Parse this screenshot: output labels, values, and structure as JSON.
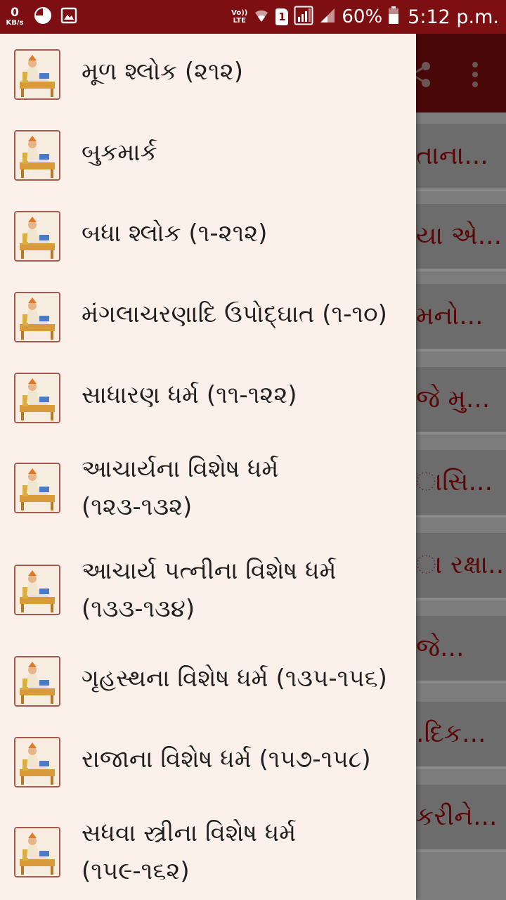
{
  "status_bar": {
    "data_speed_value": "0",
    "data_speed_unit": "KB/s",
    "network_top": "Vo))",
    "network_bottom": "LTE",
    "sim_number": "1",
    "battery_percent": "60%",
    "time": "5:12 p.m."
  },
  "background_list": {
    "items": [
      "તાના...",
      "યા એ...",
      "મનો...",
      "જે મુ...",
      "ાસિ...",
      "ા રક્ષા...",
      "જે...",
      ".દિક...",
      "કરીને..."
    ]
  },
  "drawer": {
    "items": [
      {
        "label": "મૂળ શ્લોક (૨૧૨)"
      },
      {
        "label": "બુકમાર્ક"
      },
      {
        "label": "બધા શ્લોક (૧-૨૧૨)"
      },
      {
        "label": "મંગલાચરણાદિ ઉપોદ્ઘાત (૧-૧૦)"
      },
      {
        "label": "સાધારણ ધર્મ (૧૧-૧૨૨)"
      },
      {
        "label": "આચાર્યના વિશેષ ધર્મ (૧૨૩-૧૩૨)"
      },
      {
        "label": "આચાર્ય પત્નીના વિશેષ ધર્મ (૧૩૩-૧૩૪)"
      },
      {
        "label": "ગૃહસ્થના વિશેષ ધર્મ (૧૩૫-૧૫૬)"
      },
      {
        "label": "રાજાના વિશેષ ધર્મ (૧૫૭-૧૫૮)"
      },
      {
        "label": "સધવા સ્ત્રીના વિશેષ ધર્મ (૧૫૯-૧૬૨)"
      }
    ]
  },
  "colors": {
    "status_bar": "#7d0e12",
    "drawer_background": "#fbf1ea",
    "thumb_border": "#a45a4c",
    "background_text": "#5a0507"
  }
}
